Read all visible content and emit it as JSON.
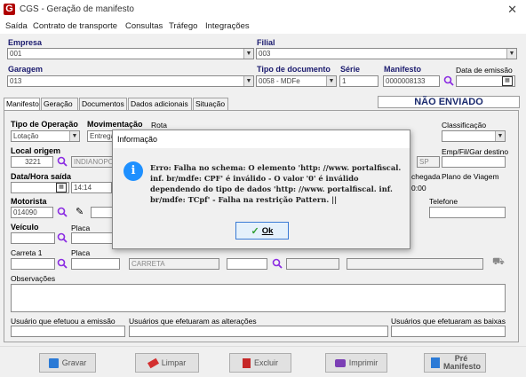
{
  "window": {
    "title": "CGS - Geração de manifesto",
    "close_glyph": "✕",
    "app_icon": "G"
  },
  "menu": [
    "Saída",
    "Contrato de transporte",
    "Consultas",
    "Tráfego",
    "Integrações"
  ],
  "header": {
    "empresa_label": "Empresa",
    "empresa_value": "001",
    "filial_label": "Filial",
    "filial_value": "003",
    "garagem_label": "Garagem",
    "garagem_value": "013",
    "tipo_doc_label": "Tipo de documento",
    "tipo_doc_value": "0058 - MDFe",
    "serie_label": "Série",
    "serie_value": "1",
    "manifesto_label": "Manifesto",
    "manifesto_value": "0000008133",
    "data_emissao_label": "Data de emissão",
    "status": "NÃO ENVIADO"
  },
  "tabs": [
    "Manifesto",
    "Geração",
    "Documentos",
    "Dados adicionais",
    "Situação"
  ],
  "form": {
    "tipo_operacao_label": "Tipo de Operação",
    "tipo_operacao_value": "Lotação",
    "movimentacao_label": "Movimentação",
    "movimentacao_value": "Entrega",
    "rota_label": "Rota",
    "classificacao_label": "Classificação",
    "local_origem_label": "Local origem",
    "local_origem_code": "3221",
    "local_origem_name": "INDIANOPO",
    "uf_value": "SP",
    "emp_label": "Emp/Fil/Gar destino",
    "data_hora_label": "Data/Hora saída",
    "hora_value": "14:14",
    "chegada_label": "chegada",
    "chegada_value": "0:00",
    "plano_label": "Plano de Viagem",
    "motorista_label": "Motorista",
    "motorista_value": "014090",
    "telefone_label": "Telefone",
    "veiculo_label": "Veículo",
    "placa_label": "Placa",
    "carreta_label": "Carreta 1",
    "carreta_tipo_value": "CARRETA",
    "observacoes_label": "Observações",
    "usuario_emissao_label": "Usuário que efetuou a emissão",
    "usuarios_alteracoes_label": "Usuários que efetuaram as alterações",
    "usuarios_baixas_label": "Usuários que efetuaram as baixas"
  },
  "buttons": {
    "gravar": "Gravar",
    "limpar": "Limpar",
    "excluir": "Excluir",
    "imprimir": "Imprimir",
    "pre_manifesto": "Pré Manifesto"
  },
  "dialog": {
    "title": "Informação",
    "icon": "i",
    "message": "Erro: Falha no schema: O elemento 'http: //www. portalfiscal. inf. br/mdfe: CPF' é inválido - O valor '0' é inválido dependendo do tipo de dados 'http: //www. portalfiscal. inf. br/mdfe: TCpf' - Falha na restrição Pattern. ||",
    "ok_label": "Ok",
    "ok_check": "✓"
  },
  "colors": {
    "label_blue": "#1a1a6e",
    "status_blue": "#1a2a6e",
    "info_icon": "#1e90ff",
    "brand_red": "#b00000"
  }
}
